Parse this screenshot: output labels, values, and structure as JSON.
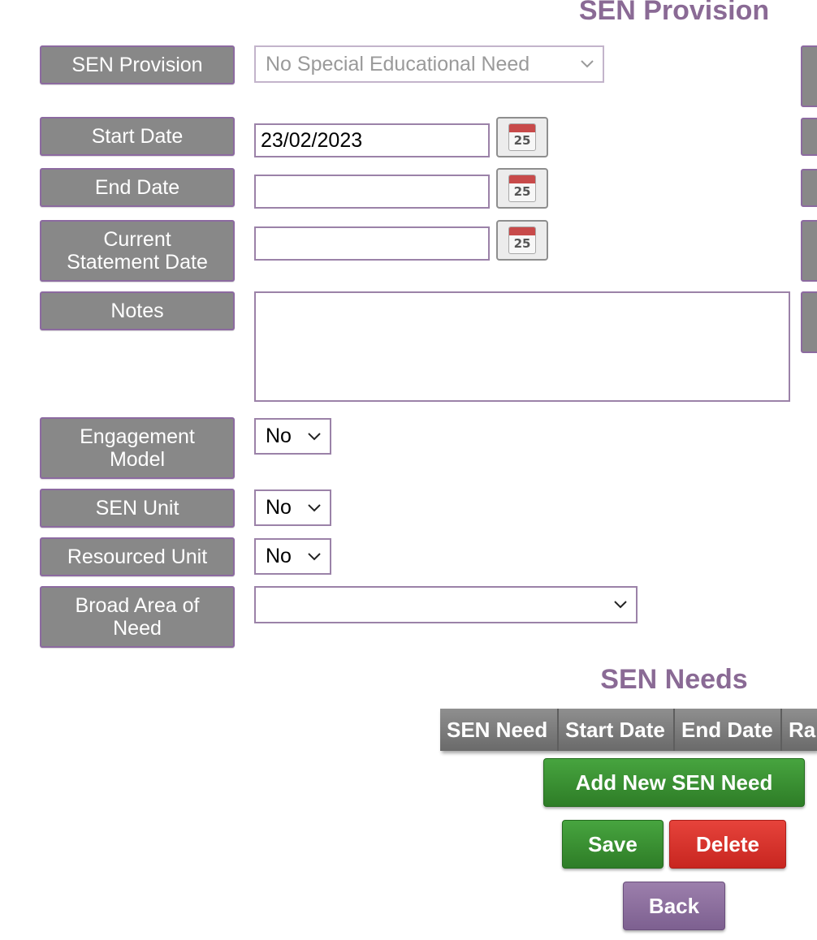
{
  "page_title": "SEN Provision",
  "form": {
    "sen_provision": {
      "label": "SEN Provision",
      "value": "No Special Educational Need"
    },
    "start_date": {
      "label": "Start Date",
      "value": "23/02/2023"
    },
    "end_date": {
      "label": "End Date",
      "value": ""
    },
    "current_statement_date": {
      "label_line1": "Current",
      "label_line2": "Statement Date",
      "value": ""
    },
    "notes": {
      "label": "Notes",
      "value": ""
    },
    "engagement_model": {
      "label_line1": "Engagement",
      "label_line2": "Model",
      "value": "No"
    },
    "sen_unit": {
      "label": "SEN Unit",
      "value": "No"
    },
    "resourced_unit": {
      "label": "Resourced Unit",
      "value": "No"
    },
    "broad_area_of_need": {
      "label_line1": "Broad Area of",
      "label_line2": "Need",
      "value": ""
    }
  },
  "calendar_icon_number": "25",
  "sen_needs": {
    "title": "SEN Needs",
    "columns": [
      "SEN Need",
      "Start Date",
      "End Date",
      "Ra"
    ],
    "add_button": "Add New SEN Need"
  },
  "actions": {
    "save": "Save",
    "delete": "Delete",
    "back": "Back"
  },
  "colors": {
    "accent": "#8a6a95",
    "label_bg": "#888888",
    "green": "#2e7d27",
    "red": "#d4302a",
    "purple": "#8a6d9c"
  }
}
